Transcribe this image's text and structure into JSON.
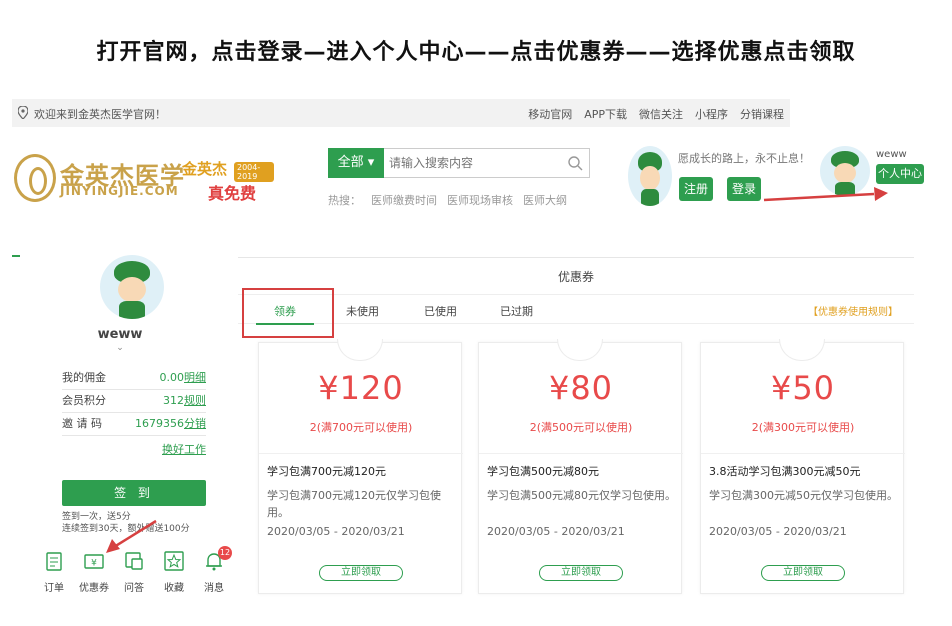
{
  "headline": "打开官网，点击登录—进入个人中心——点击优惠券——选择优惠点击领取",
  "topbar": {
    "welcome": "欢迎来到金英杰医学官网！",
    "links": [
      "移动官网",
      "APP下载",
      "微信关注",
      "小程序",
      "分销课程"
    ]
  },
  "logo": {
    "main": "金英杰医学",
    "sub": "JINYINGJIE.COM",
    "promo_brand": "金英杰",
    "promo_years": "2004-2019",
    "promo_free": "真免费"
  },
  "search": {
    "category": "全部",
    "placeholder": "请输入搜索内容",
    "hot_label": "热搜：",
    "hot_terms": [
      "医师缴费时间",
      "医师现场审核",
      "医师大纲"
    ]
  },
  "header_user": {
    "greeting": "愿成长的路上，永不止息！",
    "register": "注册",
    "login": "登录",
    "mini_name": "weww",
    "personal_center": "个人中心"
  },
  "left_panel": {
    "username": "weww",
    "stats": [
      {
        "label": "我的佣金",
        "value": "0.00",
        "action": "明细"
      },
      {
        "label": "会员积分",
        "value": "312",
        "action": "规则"
      },
      {
        "label": "邀 请 码",
        "value": "1679356",
        "action": "分销"
      }
    ],
    "change_job": "换好工作",
    "signin": "签 到",
    "sign_note_1": "签到一次，送5分",
    "sign_note_2": "连续签到30天，额外赠送100分",
    "shortcuts": [
      {
        "label": "订单",
        "icon": "order-icon"
      },
      {
        "label": "优惠券",
        "icon": "coupon-icon"
      },
      {
        "label": "问答",
        "icon": "qa-icon"
      },
      {
        "label": "收藏",
        "icon": "star-icon"
      },
      {
        "label": "消息",
        "icon": "bell-icon",
        "badge": "12"
      }
    ]
  },
  "main_panel": {
    "title": "优惠券",
    "tabs": [
      "领券",
      "未使用",
      "已使用",
      "已过期"
    ],
    "rules_link": "【优惠券使用规则】",
    "coupons": [
      {
        "amount": "¥120",
        "condition": "2(满700元可以使用)",
        "name": "学习包满700元减120元",
        "desc": "学习包满700元减120元仅学习包使用。",
        "dates": "2020/03/05 - 2020/03/21",
        "button": "立即领取"
      },
      {
        "amount": "¥80",
        "condition": "2(满500元可以使用)",
        "name": "学习包满500元减80元",
        "desc": "学习包满500元减80元仅学习包使用。",
        "dates": "2020/03/05 - 2020/03/21",
        "button": "立即领取"
      },
      {
        "amount": "¥50",
        "condition": "2(满300元可以使用)",
        "name": "3.8活动学习包满300元减50元",
        "desc": "学习包满300元减50元仅学习包使用。",
        "dates": "2020/03/05 - 2020/03/21",
        "button": "立即领取"
      }
    ]
  },
  "colors": {
    "brand_green": "#2e9e4f",
    "price_red": "#e84a4a",
    "annotation_red": "#d64040",
    "gold": "#c9a24a"
  }
}
